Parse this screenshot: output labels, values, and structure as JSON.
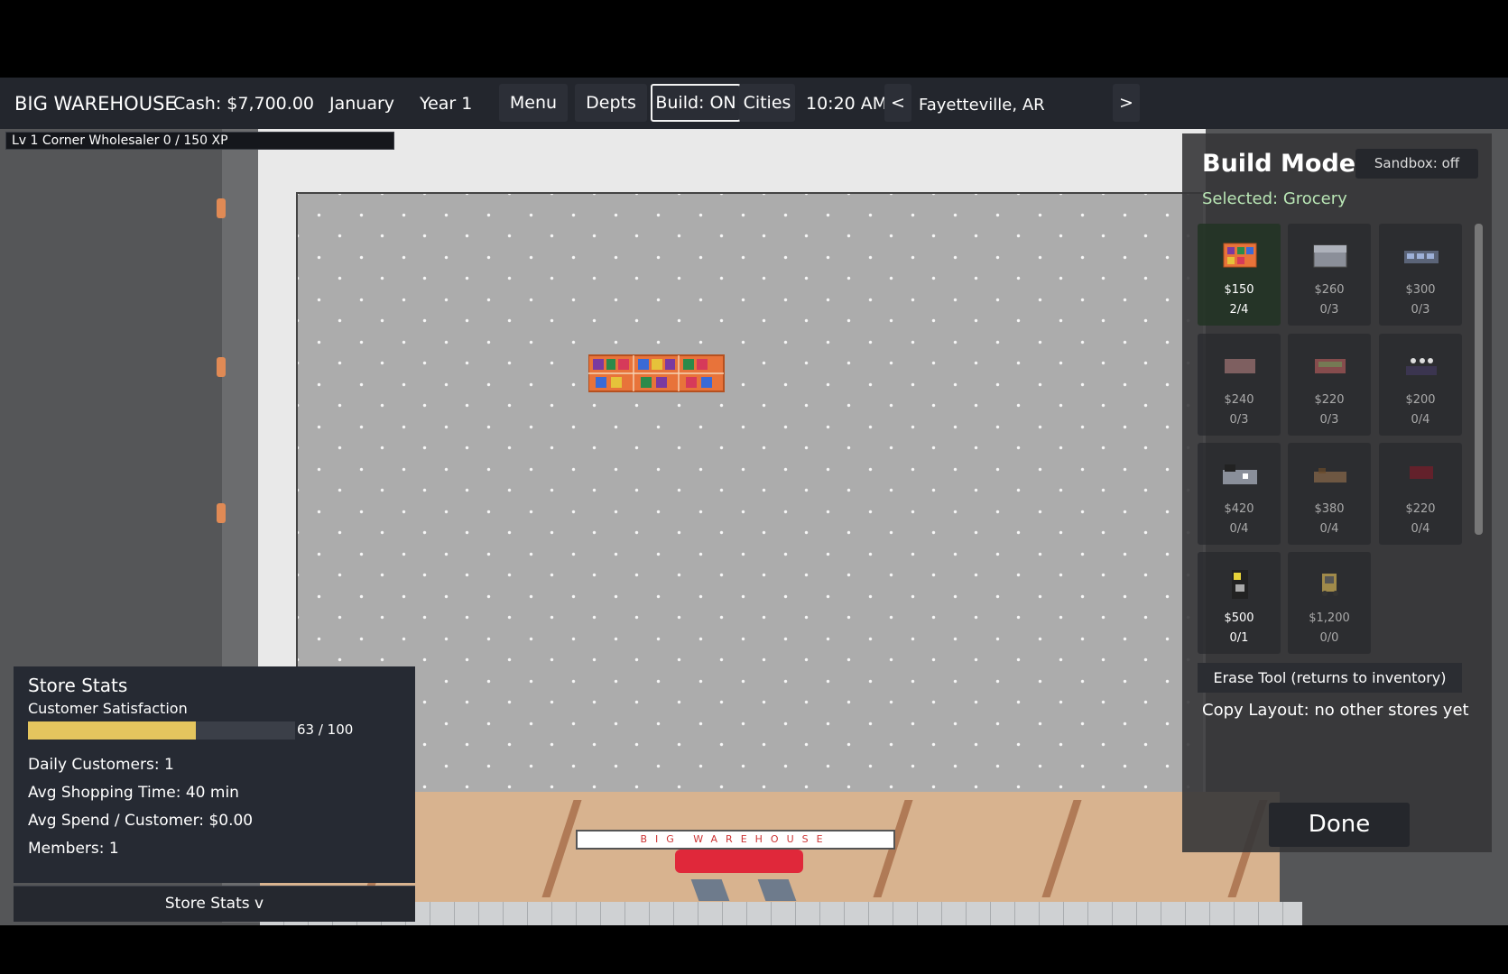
{
  "topbar": {
    "store_name": "BIG WAREHOUSE",
    "cash": "Cash: $7,700.00",
    "month": "January",
    "year": "Year 1",
    "menu_label": "Menu",
    "depts_label": "Depts",
    "build_label": "Build: ON",
    "cities_label": "Cities",
    "time": "10:20 AM",
    "prev_city": "<",
    "city": "Fayetteville, AR",
    "next_city": ">"
  },
  "level": {
    "text": "Lv 1  Corner Wholesaler    0 / 150 XP",
    "xp_progress": 0
  },
  "storefront": {
    "sign_text": "BIG WAREHOUSE"
  },
  "build_mode": {
    "title": "Build Mode",
    "sandbox_label": "Sandbox: off",
    "selected_label": "Selected: Grocery",
    "items": [
      {
        "price": "$150",
        "count": "2/4",
        "icon": "grocery-shelf-icon",
        "selected": true,
        "available": true
      },
      {
        "price": "$260",
        "count": "0/3",
        "icon": "freezer-icon",
        "selected": false,
        "available": false
      },
      {
        "price": "$300",
        "count": "0/3",
        "icon": "electronics-shelf-icon",
        "selected": false,
        "available": false
      },
      {
        "price": "$240",
        "count": "0/3",
        "icon": "bakery-rack-icon",
        "selected": false,
        "available": false
      },
      {
        "price": "$220",
        "count": "0/3",
        "icon": "produce-stand-icon",
        "selected": false,
        "available": false
      },
      {
        "price": "$200",
        "count": "0/4",
        "icon": "clothing-rack-icon",
        "selected": false,
        "available": false
      },
      {
        "price": "$420",
        "count": "0/4",
        "icon": "appliance-display-icon",
        "selected": false,
        "available": false
      },
      {
        "price": "$380",
        "count": "0/4",
        "icon": "furniture-display-icon",
        "selected": false,
        "available": false
      },
      {
        "price": "$220",
        "count": "0/4",
        "icon": "toy-shelf-icon",
        "selected": false,
        "available": false
      },
      {
        "price": "$500",
        "count": "0/1",
        "icon": "atm-kiosk-icon",
        "selected": false,
        "available": true
      },
      {
        "price": "$1,200",
        "count": "0/0",
        "icon": "forklift-icon",
        "selected": false,
        "available": false
      }
    ],
    "erase_label": "Erase Tool (returns to inventory)",
    "copy_layout": "Copy Layout: no other stores yet",
    "done_label": "Done"
  },
  "store_stats": {
    "title": "Store Stats",
    "satisfaction_label": "Customer Satisfaction",
    "satisfaction_value": 63,
    "satisfaction_text": "63 / 100",
    "daily_customers": "Daily Customers:  1",
    "avg_shopping_time": "Avg Shopping Time:  40 min",
    "avg_spend": "Avg Spend / Customer:  $0.00",
    "members": "Members:  1",
    "toggle_label": "Store Stats  v"
  },
  "colors": {
    "satisfaction_bar": "#e4c55e",
    "selected_text": "#b9e6b5",
    "awning": "#e0283a"
  }
}
